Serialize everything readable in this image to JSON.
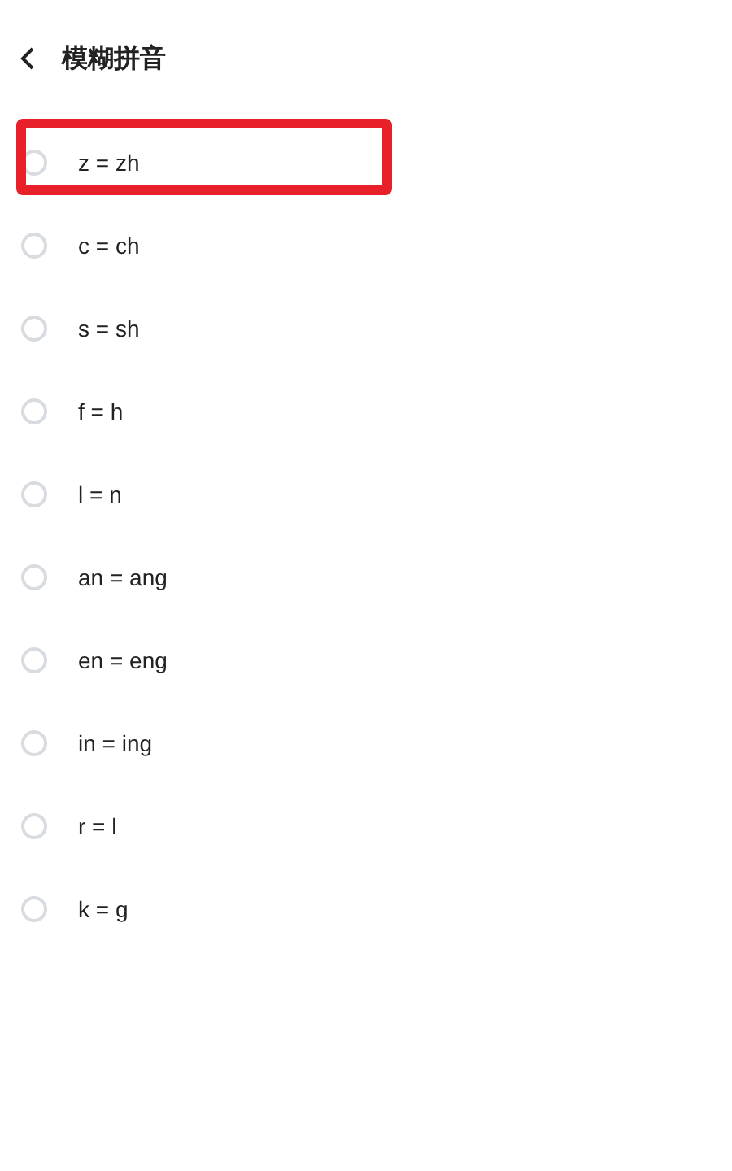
{
  "header": {
    "title": "模糊拼音"
  },
  "options": [
    {
      "label": "z = zh",
      "checked": false,
      "highlighted": true
    },
    {
      "label": "c = ch",
      "checked": false,
      "highlighted": false
    },
    {
      "label": "s = sh",
      "checked": false,
      "highlighted": false
    },
    {
      "label": "f = h",
      "checked": false,
      "highlighted": false
    },
    {
      "label": "l = n",
      "checked": false,
      "highlighted": false
    },
    {
      "label": "an = ang",
      "checked": false,
      "highlighted": false
    },
    {
      "label": "en = eng",
      "checked": false,
      "highlighted": false
    },
    {
      "label": "in = ing",
      "checked": false,
      "highlighted": false
    },
    {
      "label": "r = l",
      "checked": false,
      "highlighted": false
    },
    {
      "label": "k = g",
      "checked": false,
      "highlighted": false
    }
  ]
}
